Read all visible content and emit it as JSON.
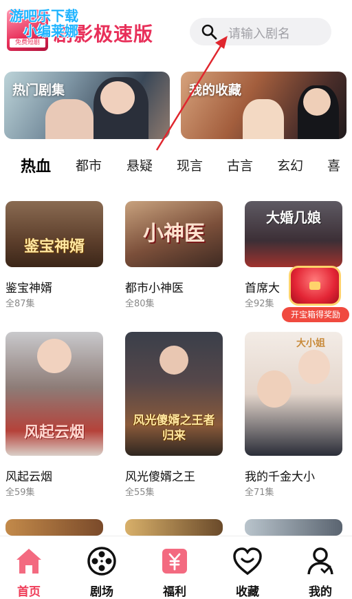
{
  "header": {
    "app_title": "剧影极速版",
    "logo_badge": "免费短剧",
    "watermark_line1": "游吧乐下载",
    "watermark_line2": "小编莱娜"
  },
  "search": {
    "placeholder": "请输入剧名",
    "icon": "search-icon"
  },
  "banners": [
    {
      "label": "热门剧集"
    },
    {
      "label": "我的收藏"
    }
  ],
  "categories": [
    "热血",
    "都市",
    "悬疑",
    "现言",
    "古言",
    "玄幻",
    "喜"
  ],
  "active_category": "热血",
  "dramas": [
    {
      "title": "鉴宝神婿",
      "episodes": "全87集",
      "cover_text": "鉴宝神婿"
    },
    {
      "title": "都市小神医",
      "episodes": "全80集",
      "cover_text": "小神医"
    },
    {
      "title": "首席大",
      "episodes": "全92集",
      "cover_text": "大婚几娘"
    },
    {
      "title": "风起云烟",
      "episodes": "全59集",
      "cover_text": "风起云烟"
    },
    {
      "title": "风光傻婿之王",
      "episodes": "全55集",
      "cover_text": "风光傻婿之王者归来"
    },
    {
      "title": "我的千金大小",
      "episodes": "全71集",
      "cover_text": "大小姐"
    }
  ],
  "reward": {
    "label": "开宝箱得奖励",
    "icon": "treasure-chest-icon"
  },
  "bottom_nav": [
    {
      "label": "首页",
      "icon": "home-icon",
      "active": true
    },
    {
      "label": "剧场",
      "icon": "film-reel-icon",
      "active": false
    },
    {
      "label": "福利",
      "icon": "yuan-gift-icon",
      "active": false
    },
    {
      "label": "收藏",
      "icon": "heart-smile-icon",
      "active": false
    },
    {
      "label": "我的",
      "icon": "user-icon",
      "active": false
    }
  ],
  "colors": {
    "accent": "#ef3b57",
    "reward": "#f04a3f",
    "arrow": "#e0262e"
  }
}
